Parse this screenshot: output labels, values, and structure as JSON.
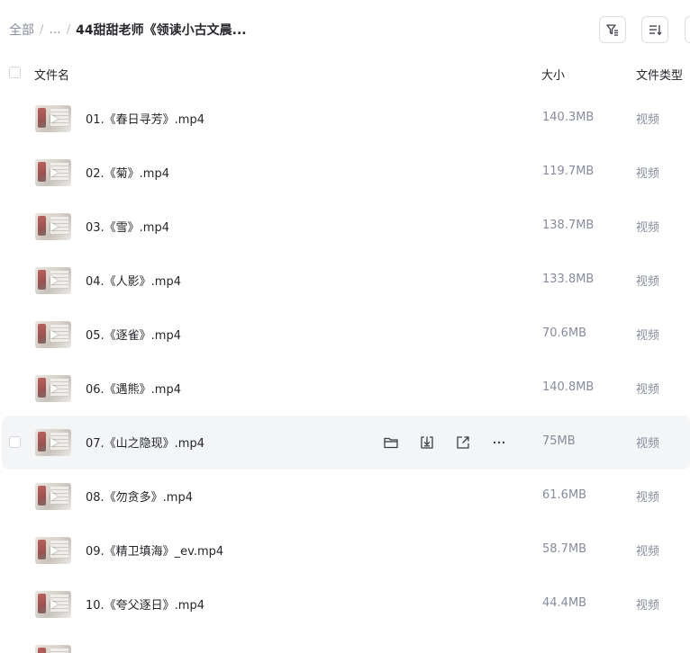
{
  "breadcrumb": {
    "root": "全部",
    "ellipsis": "...",
    "separator": "/",
    "current": "44甜甜老师《领读小古文晨..."
  },
  "toolbar": {
    "filter_icon": "filter-icon",
    "sort_icon": "sort-icon"
  },
  "columns": {
    "name": "文件名",
    "size": "大小",
    "type": "文件类型"
  },
  "row_actions": {
    "icons": [
      "folder-icon",
      "download-icon",
      "share-icon",
      "more-icon"
    ]
  },
  "files": [
    {
      "name": "01.《春日寻芳》.mp4",
      "size": "140.3MB",
      "type": "视频"
    },
    {
      "name": "02.《菊》.mp4",
      "size": "119.7MB",
      "type": "视频"
    },
    {
      "name": "03.《雪》.mp4",
      "size": "138.7MB",
      "type": "视频"
    },
    {
      "name": "04.《人影》.mp4",
      "size": "133.8MB",
      "type": "视频"
    },
    {
      "name": "05.《逐雀》.mp4",
      "size": "70.6MB",
      "type": "视频"
    },
    {
      "name": "06.《遇熊》.mp4",
      "size": "140.8MB",
      "type": "视频"
    },
    {
      "name": "07.《山之隐现》.mp4",
      "size": "75MB",
      "type": "视频",
      "hovered": true
    },
    {
      "name": "08.《勿贪多》.mp4",
      "size": "61.6MB",
      "type": "视频"
    },
    {
      "name": "09.《精卫填海》_ev.mp4",
      "size": "58.7MB",
      "type": "视频"
    },
    {
      "name": "10.《夸父逐日》.mp4",
      "size": "44.4MB",
      "type": "视频"
    },
    {
      "name": "",
      "size": "",
      "type": ""
    }
  ],
  "colors": {
    "text_primary": "#25262b",
    "text_secondary": "#878c9c",
    "hover_bg": "#f4f5f7",
    "border": "#dcdee3"
  }
}
